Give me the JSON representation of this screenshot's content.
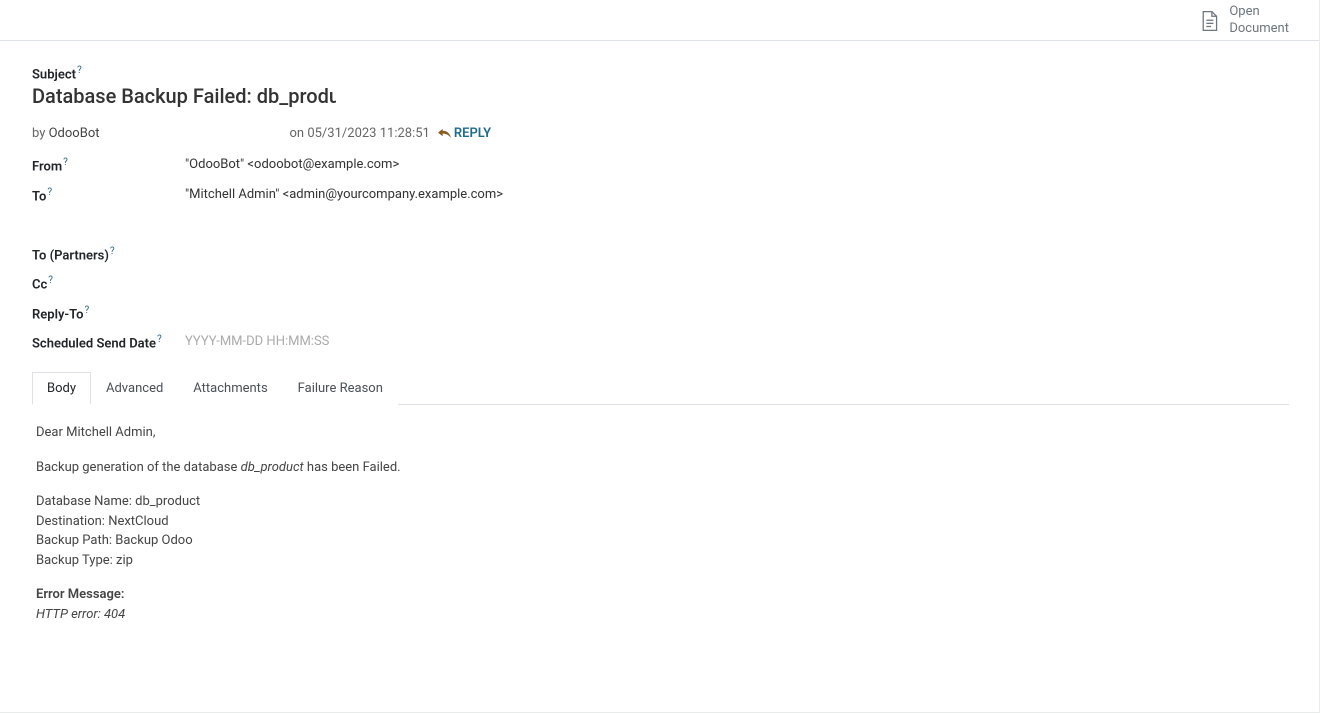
{
  "header": {
    "open_document_label": "Open\nDocument"
  },
  "subject": {
    "label": "Subject",
    "value": "Database Backup Failed: db_product"
  },
  "meta": {
    "by_prefix": "by ",
    "author": "OdooBot",
    "on_prefix": "on ",
    "date": "05/31/2023 11:28:51",
    "reply_label": "REPLY"
  },
  "fields": {
    "from_label": "From",
    "from_value": "\"OdooBot\" <odoobot@example.com>",
    "to_label": "To",
    "to_value": "\"Mitchell Admin\" <admin@yourcompany.example.com>",
    "to_partners_label": "To (Partners)",
    "cc_label": "Cc",
    "reply_to_label": "Reply-To",
    "scheduled_label": "Scheduled Send Date",
    "scheduled_placeholder": "YYYY-MM-DD HH:MM:SS"
  },
  "tabs": {
    "body": "Body",
    "advanced": "Advanced",
    "attachments": "Attachments",
    "failure": "Failure Reason"
  },
  "body": {
    "greeting": "Dear Mitchell Admin,",
    "line1_pre": "Backup generation of the database ",
    "line1_db": "db_product",
    "line1_post": " has been Failed.",
    "db_name_label": "Database Name: ",
    "db_name_value": "db_product",
    "dest_label": "Destination: ",
    "dest_value": "NextCloud",
    "path_label": "Backup Path: ",
    "path_value": "Backup Odoo",
    "type_label": "Backup Type: ",
    "type_value": "zip",
    "error_heading": "Error Message:",
    "error_msg": "HTTP error: 404"
  }
}
